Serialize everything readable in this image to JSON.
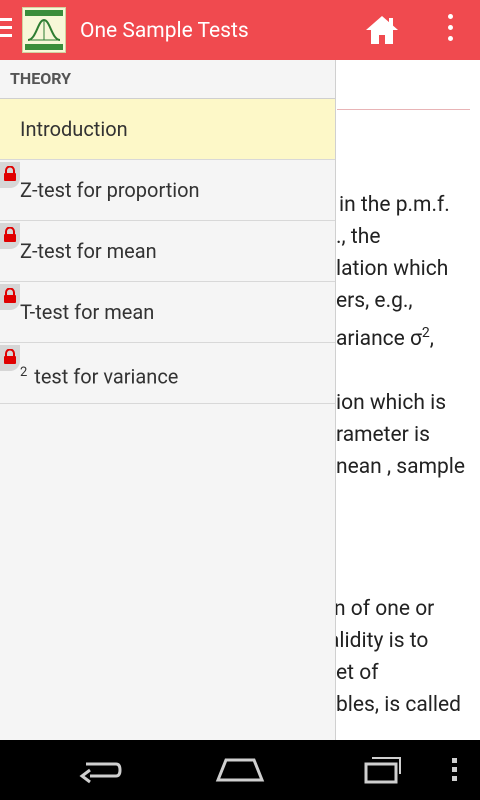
{
  "appbar": {
    "title": "One Sample Tests",
    "logo_top_text": "HYPO TESTING",
    "logo_bottom_text": "STEP BY STEP",
    "color": "#f04a4f"
  },
  "drawer": {
    "header": "THEORY",
    "items": [
      {
        "label": "Introduction",
        "locked": false,
        "active": true
      },
      {
        "label": "Z-test for proportion",
        "locked": true,
        "active": false
      },
      {
        "label": "Z-test for mean",
        "locked": true,
        "active": false
      },
      {
        "label": "T-test for mean",
        "locked": true,
        "active": false
      },
      {
        "label": "test for variance",
        "superscript": "2",
        "locked": true,
        "active": false
      }
    ]
  },
  "content": {
    "lines": [
      "g in the p.m.f.",
      "., the",
      "lation which",
      "ers, e.g.,",
      "ariance σ",
      "ion which is",
      "rameter is",
      "nean , sample",
      "on of one or",
      "alidity is to",
      "et of",
      "bles, is called"
    ],
    "sup_2": "2",
    "comma": ","
  },
  "icons": [
    "menu-icon",
    "app-logo",
    "home-icon",
    "overflow-menu-icon",
    "lock-icon",
    "back-icon",
    "home-nav-icon",
    "recent-apps-icon"
  ]
}
